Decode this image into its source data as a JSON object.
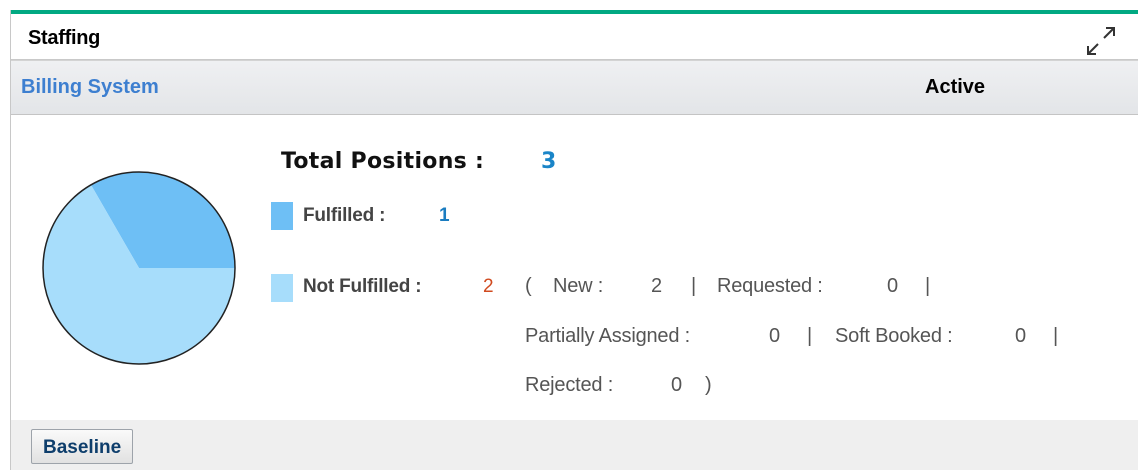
{
  "header": {
    "title": "Staffing",
    "expand_icon": "expand-icon"
  },
  "project": {
    "name": "Billing System",
    "status": "Active"
  },
  "summary": {
    "total_label": "Total Positions :",
    "total_value": "3",
    "fulfilled_label": "Fulfilled :",
    "fulfilled_value": "1",
    "fulfilled_color": "#6ebff5",
    "not_fulfilled_label": "Not Fulfilled :",
    "not_fulfilled_value": "2",
    "not_fulfilled_color": "#a7ddfb",
    "breakdown": {
      "open_paren": "(",
      "new_label": "New :",
      "new_value": "2",
      "sep": "|",
      "requested_label": "Requested :",
      "requested_value": "0",
      "partially_label": "Partially Assigned :",
      "partially_value": "0",
      "softbooked_label": "Soft Booked :",
      "softbooked_value": "0",
      "rejected_label": "Rejected :",
      "rejected_value": "0",
      "close_paren": ")"
    }
  },
  "chart_data": {
    "type": "pie",
    "categories": [
      "Fulfilled",
      "Not Fulfilled"
    ],
    "values": [
      1,
      2
    ],
    "colors": [
      "#6ebff5",
      "#a7ddfb"
    ]
  },
  "footer": {
    "baseline_button": "Baseline"
  }
}
